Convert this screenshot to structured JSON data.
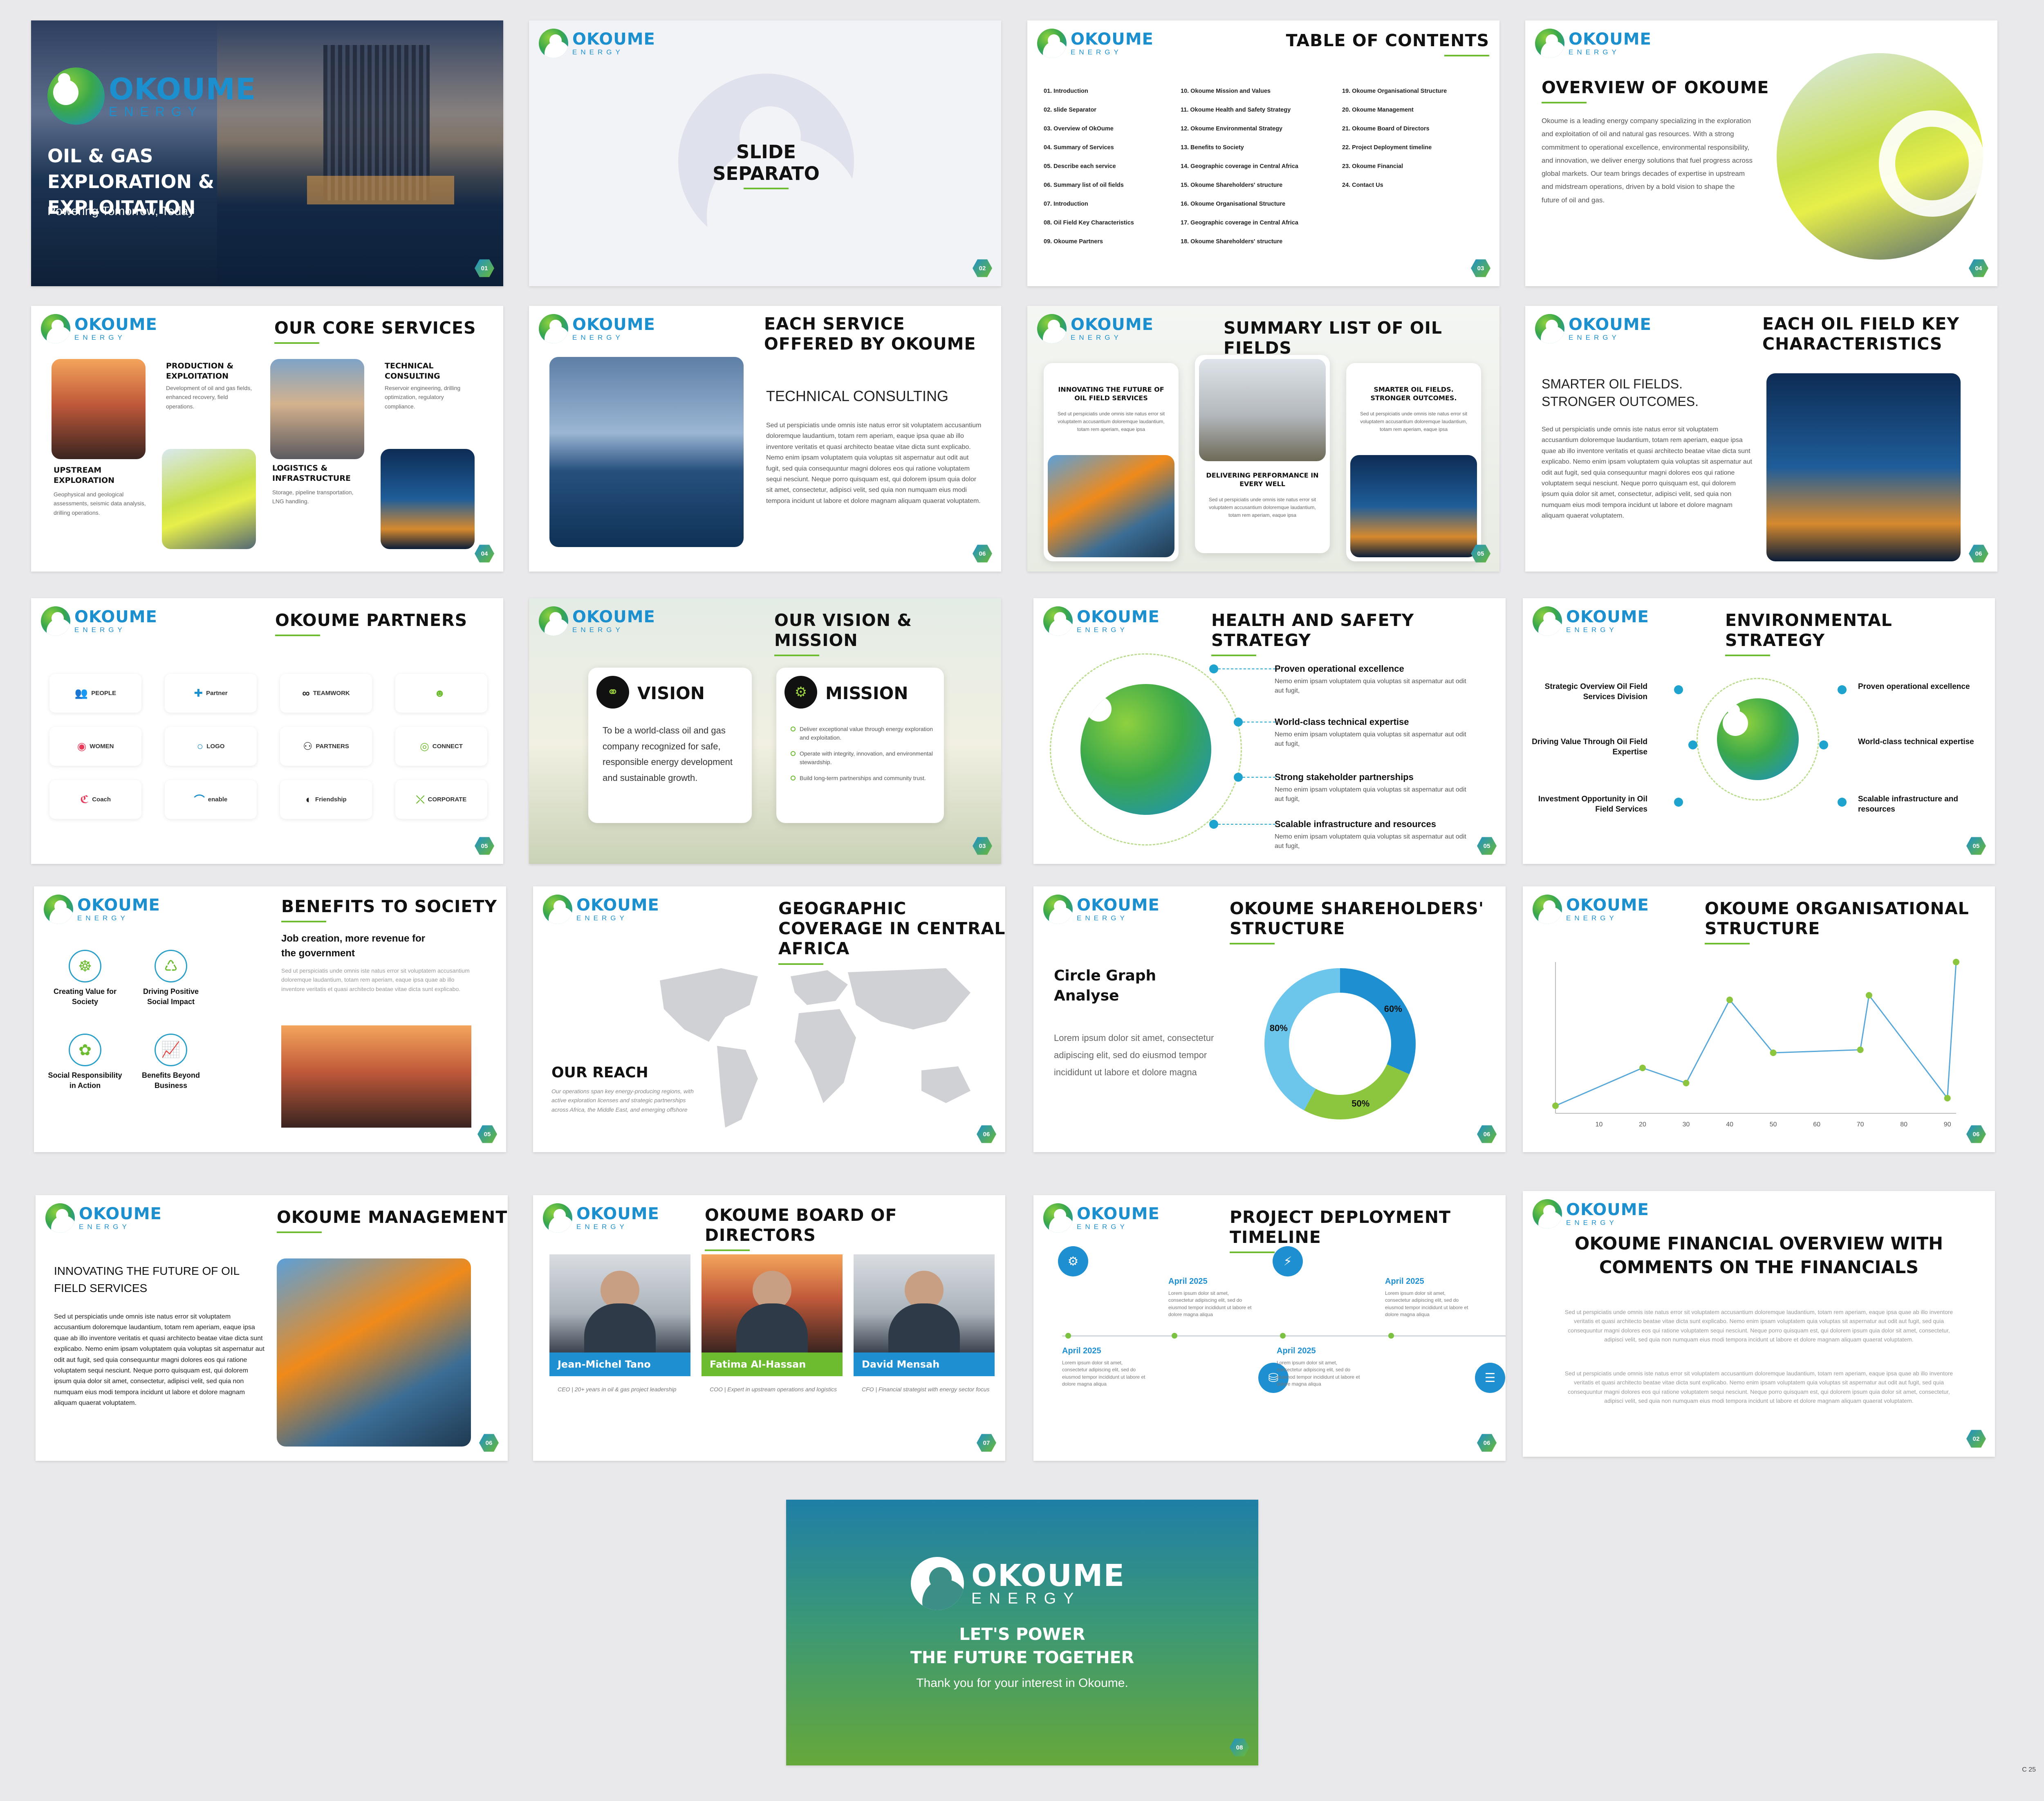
{
  "logo": {
    "name": "OKOUME",
    "sub": "ENERGY"
  },
  "slide1": {
    "title": "OIL & GAS EXPLORATION & EXPLOITATION",
    "tagline": "Powering Tomorrow, Today",
    "num": "01"
  },
  "slide2": {
    "title": "SLIDE SEPARATO",
    "num": "02"
  },
  "slide3": {
    "title": "TABLE OF CONTENTS",
    "num": "03",
    "col1": [
      "01. Introduction",
      "02. slide Separator",
      "03. Overview of OkOume",
      "04. Summary of Services",
      "05. Describe each service",
      "06. Summary list of oil fields",
      "07. Introduction",
      "08. Oil Field Key Characteristics",
      "09. Okoume Partners"
    ],
    "col2": [
      "10. Okoume Mission and Values",
      "11. Okoume Health and Safety Strategy",
      "12. Okoume Environmental Strategy",
      "13. Benefits to Society",
      "14. Geographic coverage in Central Africa",
      "15. Okoume Shareholders' structure",
      "16. Okoume Organisational Structure",
      "17. Geographic coverage in Central Africa",
      "18. Okoume Shareholders' structure"
    ],
    "col3": [
      "19. Okoume Organisational Structure",
      "20. Okoume Management",
      "21. Okoume Board of Directors",
      "22. Project Deployment timeline",
      "23. Okoume Financial",
      "24. Contact Us"
    ]
  },
  "slide4": {
    "title": "OVERVIEW OF OKOUME",
    "body": "Okoume is a leading energy company specializing in the exploration and exploitation of oil and natural gas resources. With a strong commitment to operational excellence, environmental responsibility, and innovation, we deliver energy solutions that fuel progress across global markets. Our team brings decades of expertise in upstream and midstream operations, driven by a bold vision to shape the future of oil and gas.",
    "num": "04"
  },
  "slide5": {
    "title": "OUR CORE SERVICES",
    "num": "04",
    "s1": {
      "h": "PRODUCTION & EXPLOITATION",
      "t": "Development of oil and gas fields, enhanced recovery, field operations."
    },
    "s2": {
      "h": "TECHNICAL CONSULTING",
      "t": "Reservoir engineering, drilling optimization, regulatory compliance."
    },
    "s3": {
      "h": "UPSTREAM EXPLORATION",
      "t": "Geophysical and geological assessments, seismic data analysis, drilling operations."
    },
    "s4": {
      "h": "LOGISTICS & INFRASTRUCTURE",
      "t": "Storage, pipeline transportation, LNG handling."
    }
  },
  "slide6": {
    "title": "EACH SERVICE OFFERED BY OKOUME",
    "sub": "TECHNICAL CONSULTING",
    "body": "Sed ut perspiciatis unde omnis iste natus error sit voluptatem accusantium doloremque laudantium, totam rem aperiam, eaque ipsa quae ab illo inventore veritatis et quasi architecto beatae vitae dicta sunt explicabo. Nemo enim ipsam voluptatem quia voluptas sit aspernatur aut odit aut fugit, sed quia consequuntur magni dolores eos qui ratione voluptatem sequi nesciunt. Neque porro quisquam est, qui dolorem ipsum quia dolor sit amet, consectetur, adipisci velit, sed quia non numquam eius modi tempora incidunt ut labore et dolore magnam aliquam quaerat voluptatem.",
    "num": "06"
  },
  "slide7": {
    "title": "SUMMARY LIST OF OIL FIELDS",
    "num": "05",
    "c1h": "INNOVATING THE FUTURE OF OIL FIELD SERVICES",
    "c1t": "Sed ut perspiciatis unde omnis iste natus error sit voluptatem accusantium doloremque laudantium, totam rem aperiam, eaque ipsa",
    "c2h": "DELIVERING PERFORMANCE IN EVERY WELL",
    "c2t": "Sed ut perspiciatis unde omnis iste natus error sit voluptatem accusantium doloremque laudantium, totam rem aperiam, eaque ipsa",
    "c3h": "SMARTER OIL FIELDS. STRONGER OUTCOMES.",
    "c3t": "Sed ut perspiciatis unde omnis iste natus error sit voluptatem accusantium doloremque laudantium, totam rem aperiam, eaque ipsa"
  },
  "slide8": {
    "title": "EACH OIL FIELD KEY CHARACTERISTICS",
    "sub": "SMARTER OIL FIELDS. STRONGER OUTCOMES.",
    "body": "Sed ut perspiciatis unde omnis iste natus error sit voluptatem accusantium doloremque laudantium, totam rem aperiam, eaque ipsa quae ab illo inventore veritatis et quasi architecto beatae vitae dicta sunt explicabo. Nemo enim ipsam voluptatem quia voluptas sit aspernatur aut odit aut fugit, sed quia consequuntur magni dolores eos qui ratione voluptatem sequi nesciunt. Neque porro quisquam est, qui dolorem ipsum quia dolor sit amet, consectetur, adipisci velit, sed quia non numquam eius modi tempora incidunt ut labore et dolore magnam aliquam quaerat voluptatem.",
    "num": "06"
  },
  "slide9": {
    "title": "OKOUME PARTNERS",
    "num": "05",
    "partners": [
      "PEOPLE",
      "Partner",
      "TEAMWORK",
      "",
      "WOMEN",
      "LOGO",
      "PARTNERS",
      "CONNECT",
      "Coach",
      "enable",
      "Friendship",
      "CORPORATE"
    ]
  },
  "slide10": {
    "title": "OUR VISION & MISSION",
    "num": "03",
    "vision_h": "VISION",
    "vision_t": "To be a world-class oil and gas company recognized for safe, responsible energy development and sustainable growth.",
    "mission_h": "MISSION",
    "mission_items": [
      "Deliver exceptional value through energy exploration and exploitation.",
      "Operate with integrity, innovation, and environmental stewardship.",
      "Build long-term partnerships and community trust."
    ]
  },
  "slide11": {
    "title": "HEALTH AND SAFETY STRATEGY",
    "num": "05",
    "items": [
      {
        "h": "Proven operational excellence",
        "t": "Nemo enim ipsam voluptatem quia voluptas sit aspernatur aut odit aut fugit,"
      },
      {
        "h": "World-class technical expertise",
        "t": "Nemo enim ipsam voluptatem quia voluptas sit aspernatur aut odit aut fugit,"
      },
      {
        "h": "Strong stakeholder partnerships",
        "t": "Nemo enim ipsam voluptatem quia voluptas sit aspernatur aut odit aut fugit,"
      },
      {
        "h": "Scalable infrastructure and resources",
        "t": "Nemo enim ipsam voluptatem quia voluptas sit aspernatur aut odit aut fugit,"
      }
    ]
  },
  "slide12": {
    "title": "ENVIRONMENTAL STRATEGY",
    "num": "05",
    "left": [
      "Strategic Overview Oil Field Services Division",
      "Driving Value Through Oil Field Expertise",
      "Investment Opportunity in Oil Field Services"
    ],
    "right": [
      "Proven operational excellence",
      "World-class technical expertise",
      "Scalable infrastructure and resources"
    ]
  },
  "slide13": {
    "title": "BENEFITS TO SOCIETY",
    "sub": "Job creation, more revenue for the government",
    "body": "Sed ut perspiciatis unde omnis iste natus error sit voluptatem accusantium doloremque laudantium, totam rem aperiam, eaque ipsa quae ab illo inventore veritatis et quasi architecto beatae vitae dicta sunt explicabo.",
    "icons": [
      "Creating Value for Society",
      "Driving Positive Social Impact",
      "Social Responsibility in Action",
      "Benefits Beyond Business"
    ],
    "num": "05"
  },
  "slide14": {
    "title": "GEOGRAPHIC COVERAGE IN CENTRAL AFRICA",
    "sub": "OUR REACH",
    "body": "Our operations span key energy-producing regions, with active exploration licenses and strategic partnerships across Africa, the Middle East, and emerging offshore",
    "num": "06"
  },
  "slide15": {
    "title": "OKOUME SHAREHOLDERS' STRUCTURE",
    "sub": "Circle Graph Analyse",
    "body": "Lorem ipsum dolor sit amet, consectetur adipiscing elit, sed do eiusmod tempor incididunt ut labore et dolore magna",
    "num": "06"
  },
  "slide16": {
    "title": "OKOUME ORGANISATIONAL STRUCTURE",
    "num": "06"
  },
  "slide17": {
    "title": "OKOUME MANAGEMENT",
    "sub": "INNOVATING THE FUTURE OF OIL FIELD SERVICES",
    "body": "Sed ut perspiciatis unde omnis iste natus error sit voluptatem accusantium doloremque laudantium, totam rem aperiam, eaque ipsa quae ab illo inventore veritatis et quasi architecto beatae vitae dicta sunt explicabo. Nemo enim ipsam voluptatem quia voluptas sit aspernatur aut odit aut fugit, sed quia consequuntur magni dolores eos qui ratione voluptatem sequi nesciunt. Neque porro quisquam est, qui dolorem ipsum quia dolor sit amet, consectetur, adipisci velit, sed quia non numquam eius modi tempora incidunt ut labore et dolore magnam aliquam quaerat voluptatem.",
    "num": "06"
  },
  "slide18": {
    "title": "OKOUME BOARD OF DIRECTORS",
    "num": "07",
    "directors": [
      {
        "name": "Jean-Michel Tano",
        "role": "CEO | 20+ years in oil & gas project leadership"
      },
      {
        "name": "Fatima Al-Hassan",
        "role": "COO | Expert in upstream operations and logistics"
      },
      {
        "name": "David Mensah",
        "role": "CFO | Financial strategist with energy sector focus"
      }
    ]
  },
  "slide19": {
    "title": "PROJECT DEPLOYMENT TIMELINE",
    "num": "06",
    "date": "April 2025",
    "text": "Lorem ipsum dolor sit amet, consectetur adipiscing elit, sed do eiusmod tempor incididunt ut labore et dolore magna aliqua"
  },
  "slide20": {
    "title": "OKOUME FINANCIAL OVERVIEW WITH COMMENTS ON THE FINANCIALS",
    "p1": "Sed ut perspiciatis unde omnis iste natus error sit voluptatem accusantium doloremque laudantium, totam rem aperiam, eaque ipsa quae ab illo inventore veritatis et quasi architecto beatae vitae dicta sunt explicabo. Nemo enim ipsam voluptatem quia voluptas sit aspernatur aut odit aut fugit, sed quia consequuntur magni dolores eos qui ratione voluptatem sequi nesciunt. Neque porro quisquam est, qui dolorem ipsum quia dolor sit amet, consectetur, adipisci velit, sed quia non numquam eius modi tempora incidunt ut labore et dolore magnam aliquam quaerat voluptatem.",
    "p2": "Sed ut perspiciatis unde omnis iste natus error sit voluptatem accusantium doloremque laudantium, totam rem aperiam, eaque ipsa quae ab illo inventore veritatis et quasi architecto beatae vitae dicta sunt explicabo. Nemo enim ipsam voluptatem quia voluptas sit aspernatur aut odit aut fugit, sed quia consequuntur magni dolores eos qui ratione voluptatem sequi nesciunt. Neque porro quisquam est, qui dolorem ipsum quia dolor sit amet, consectetur, adipisci velit, sed quia non numquam eius modi tempora incidunt ut labore et dolore magnam aliquam quaerat voluptatem.",
    "num": "02"
  },
  "slide21": {
    "l1": "LET'S POWER",
    "l2": "THE FUTURE TOGETHER",
    "thanks": "Thank you for your interest in Okoume.",
    "num": "08"
  },
  "footer_code": "C 25",
  "chart_data": [
    {
      "type": "pie",
      "title": "",
      "categories": [
        "",
        "",
        ""
      ],
      "values": [
        60,
        50,
        80
      ],
      "labels": [
        "60%",
        "50%",
        "80%"
      ],
      "colors": [
        "#1e8fd0",
        "#8cc63f",
        "#6cc5eb"
      ]
    },
    {
      "type": "line",
      "title": "",
      "x": [
        0,
        20,
        30,
        40,
        50,
        70,
        72,
        90,
        92
      ],
      "y": [
        5,
        30,
        20,
        75,
        40,
        42,
        78,
        10,
        100
      ],
      "xticks": [
        10,
        20,
        30,
        40,
        50,
        60,
        70,
        80,
        90
      ],
      "xlim": [
        0,
        92
      ],
      "ylim": [
        0,
        100
      ]
    }
  ]
}
